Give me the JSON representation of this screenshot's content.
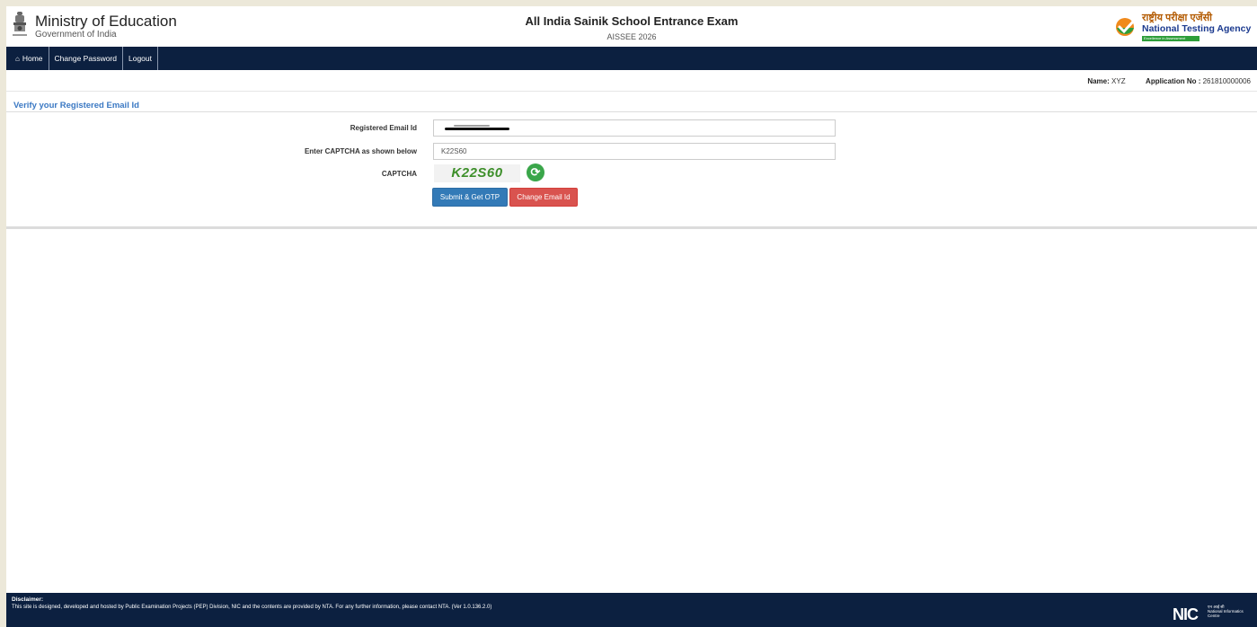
{
  "header": {
    "ministry_title": "Ministry of Education",
    "ministry_subtitle": "Government of India",
    "exam_title": "All India Sainik School Entrance Exam",
    "exam_subtitle": "AISSEE 2026",
    "nta_hindi": "राष्ट्रीय परीक्षा एजेंसी",
    "nta_english": "National Testing Agency",
    "nta_tagline": "Excellence in Assessment"
  },
  "nav": {
    "home": "Home",
    "change_password": "Change Password",
    "logout": "Logout"
  },
  "candidate": {
    "name_label": "Name:",
    "name_value": "XYZ",
    "app_label": "Application No :",
    "app_value": "261810000006"
  },
  "panel": {
    "title": "Verify your Registered Email Id"
  },
  "form": {
    "email_label": "Registered Email Id",
    "captcha_entry_label": "Enter CAPTCHA as shown below",
    "captcha_entry_value": "K22S60",
    "captcha_label": "CAPTCHA",
    "captcha_image_text": "K22S60",
    "submit_label": "Submit & Get OTP",
    "change_email_label": "Change Email Id"
  },
  "footer": {
    "disclaimer_title": "Disclaimer:",
    "disclaimer_text": "This site is designed, developed and hosted by Public Examination Projects (PEP) Division, NIC and the contents are provided by NTA. For any further information, please contact NTA. (Ver 1.0.136.2.0)",
    "nic_logo": "NIC",
    "nic_hindi": "एन आई सी",
    "nic_text": "National Informatics Centre"
  },
  "icons": {
    "home": "home-icon",
    "refresh": "refresh-icon",
    "emblem": "national-emblem-icon",
    "nta_logo": "nta-check-logo-icon"
  },
  "colors": {
    "navbar": "#0c2040",
    "panel_title": "#3a78c3",
    "primary_button": "#337ab7",
    "danger_button": "#d9534f",
    "captcha_text": "#3d8f2a"
  }
}
